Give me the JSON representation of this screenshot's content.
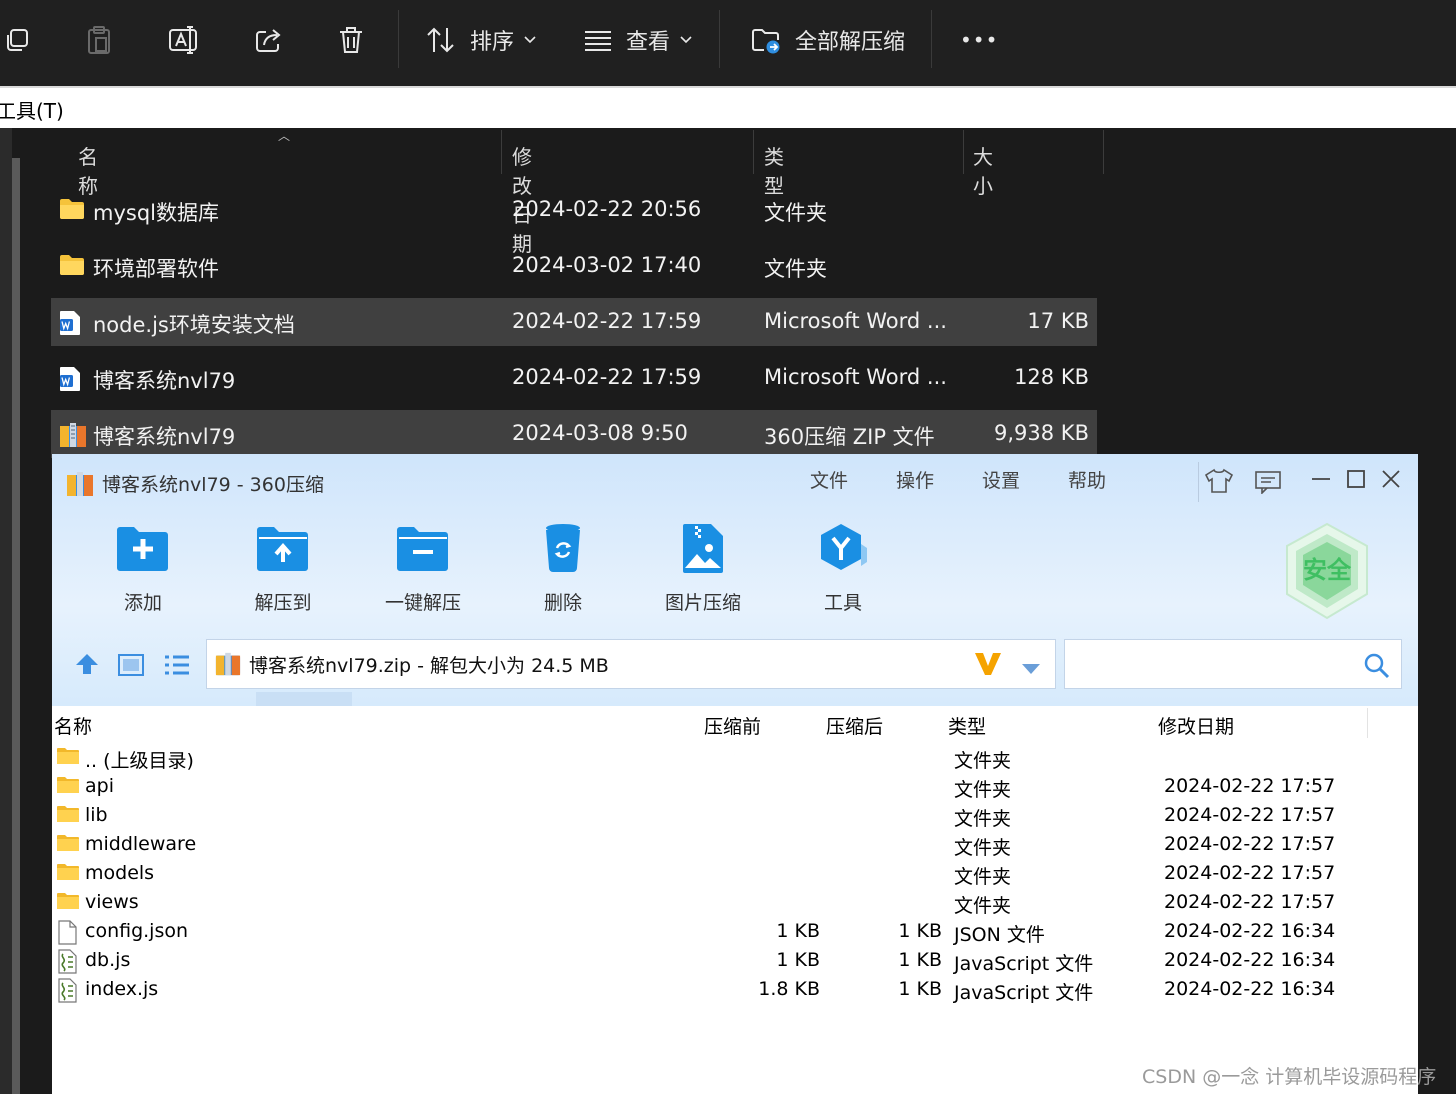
{
  "toolbar": {
    "sort_label": "排序",
    "view_label": "查看",
    "extract_all_label": "全部解压缩",
    "more_label": "•••"
  },
  "menubar": {
    "tools_label": "工具(T)"
  },
  "explorer": {
    "columns": {
      "name": "名称",
      "modified": "修改日期",
      "type": "类型",
      "size": "大小"
    },
    "rows": [
      {
        "name": "mysql数据库",
        "modified": "2024-02-22 20:56",
        "type": "文件夹",
        "size": "",
        "icon": "folder-icon"
      },
      {
        "name": "环境部署软件",
        "modified": "2024-03-02 17:40",
        "type": "文件夹",
        "size": "",
        "icon": "folder-icon"
      },
      {
        "name": "node.js环境安装文档",
        "modified": "2024-02-22 17:59",
        "type": "Microsoft Word ...",
        "size": "17 KB",
        "icon": "word-doc-icon"
      },
      {
        "name": "博客系统nvl79",
        "modified": "2024-02-22 17:59",
        "type": "Microsoft Word ...",
        "size": "128 KB",
        "icon": "word-doc-icon"
      },
      {
        "name": "博客系统nvl79",
        "modified": "2024-03-08 9:50",
        "type": "360压缩 ZIP 文件",
        "size": "9,938 KB",
        "icon": "zip-archive-icon"
      }
    ]
  },
  "zip_window": {
    "title": "博客系统nvl79 - 360压缩",
    "menu": {
      "file": "文件",
      "operate": "操作",
      "settings": "设置",
      "help": "帮助"
    },
    "buttons": {
      "add": "添加",
      "extract_to": "解压到",
      "one_click": "一键解压",
      "delete": "删除",
      "image_compress": "图片压缩",
      "tools": "工具"
    },
    "badge_text": "安全",
    "path": "博客系统nvl79.zip - 解包大小为 24.5 MB",
    "search_placeholder": "",
    "columns": {
      "name": "名称",
      "before": "压缩前",
      "after": "压缩后",
      "type": "类型",
      "modified": "修改日期"
    },
    "rows": [
      {
        "name": ".. (上级目录)",
        "before": "",
        "after": "",
        "type": "文件夹",
        "modified": "",
        "icon": "folder-icon"
      },
      {
        "name": "api",
        "before": "",
        "after": "",
        "type": "文件夹",
        "modified": "2024-02-22 17:57",
        "icon": "folder-icon"
      },
      {
        "name": "lib",
        "before": "",
        "after": "",
        "type": "文件夹",
        "modified": "2024-02-22 17:57",
        "icon": "folder-icon"
      },
      {
        "name": "middleware",
        "before": "",
        "after": "",
        "type": "文件夹",
        "modified": "2024-02-22 17:57",
        "icon": "folder-icon"
      },
      {
        "name": "models",
        "before": "",
        "after": "",
        "type": "文件夹",
        "modified": "2024-02-22 17:57",
        "icon": "folder-icon"
      },
      {
        "name": "views",
        "before": "",
        "after": "",
        "type": "文件夹",
        "modified": "2024-02-22 17:57",
        "icon": "folder-icon"
      },
      {
        "name": "config.json",
        "before": "1 KB",
        "after": "1 KB",
        "type": "JSON 文件",
        "modified": "2024-02-22 16:34",
        "icon": "blank-file-icon"
      },
      {
        "name": "db.js",
        "before": "1 KB",
        "after": "1 KB",
        "type": "JavaScript 文件",
        "modified": "2024-02-22 16:34",
        "icon": "script-file-icon"
      },
      {
        "name": "index.js",
        "before": "1.8 KB",
        "after": "1 KB",
        "type": "JavaScript 文件",
        "modified": "2024-02-22 16:34",
        "icon": "script-file-icon"
      }
    ]
  },
  "watermark": "CSDN @一念 计算机毕设源码程序",
  "colors": {
    "explorer_bg": "#1b1b1b",
    "selected_row": "#404040",
    "zip_header": "#d6eafc",
    "accent_blue": "#1a8fe3"
  }
}
